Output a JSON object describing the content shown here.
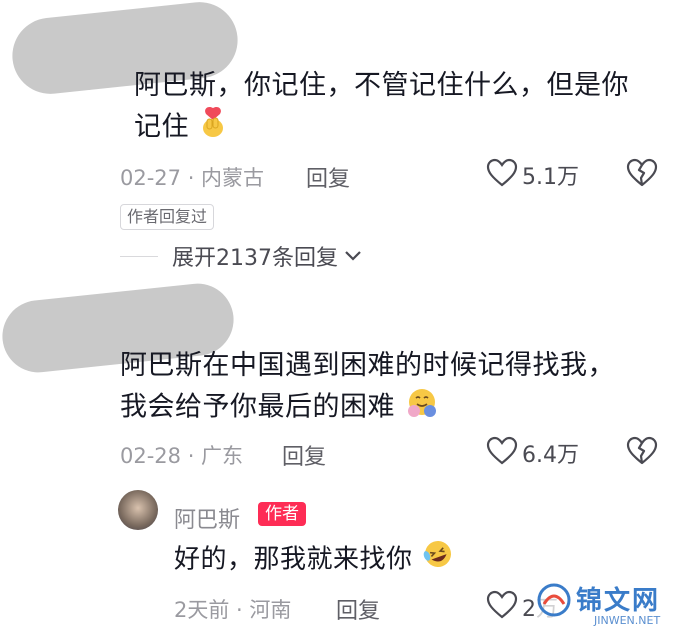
{
  "comments": [
    {
      "text_line1": "阿巴斯，你记住，不管记住什么，但是你",
      "text_line2": "记住",
      "emoji": "finger-heart-emoji",
      "date_location": "02-27 · 内蒙古",
      "reply_label": "回复",
      "likes": "5.1万",
      "author_replied_badge": "作者回复过",
      "expand_label": "展开2137条回复"
    },
    {
      "text_line1": "阿巴斯在中国遇到困难的时候记得找我，",
      "text_line2": "我会给予你最后的困难",
      "emoji": "hugging-face-emoji",
      "date_location": "02-28 · 广东",
      "reply_label": "回复",
      "likes": "6.4万"
    }
  ],
  "reply": {
    "author": "阿巴斯",
    "author_badge": "作者",
    "text": "好的，那我就来找你",
    "emoji": "rolling-laughing-emoji",
    "date_location": "2天前 · 河南",
    "reply_label": "回复",
    "likes": "2",
    "likes_suffix": "万"
  },
  "watermark": {
    "brand": "锦文网",
    "url": "JINWEN.NET"
  },
  "colors": {
    "accent": "#fe2c55",
    "text": "#161823",
    "meta": "#9a9aa0"
  }
}
